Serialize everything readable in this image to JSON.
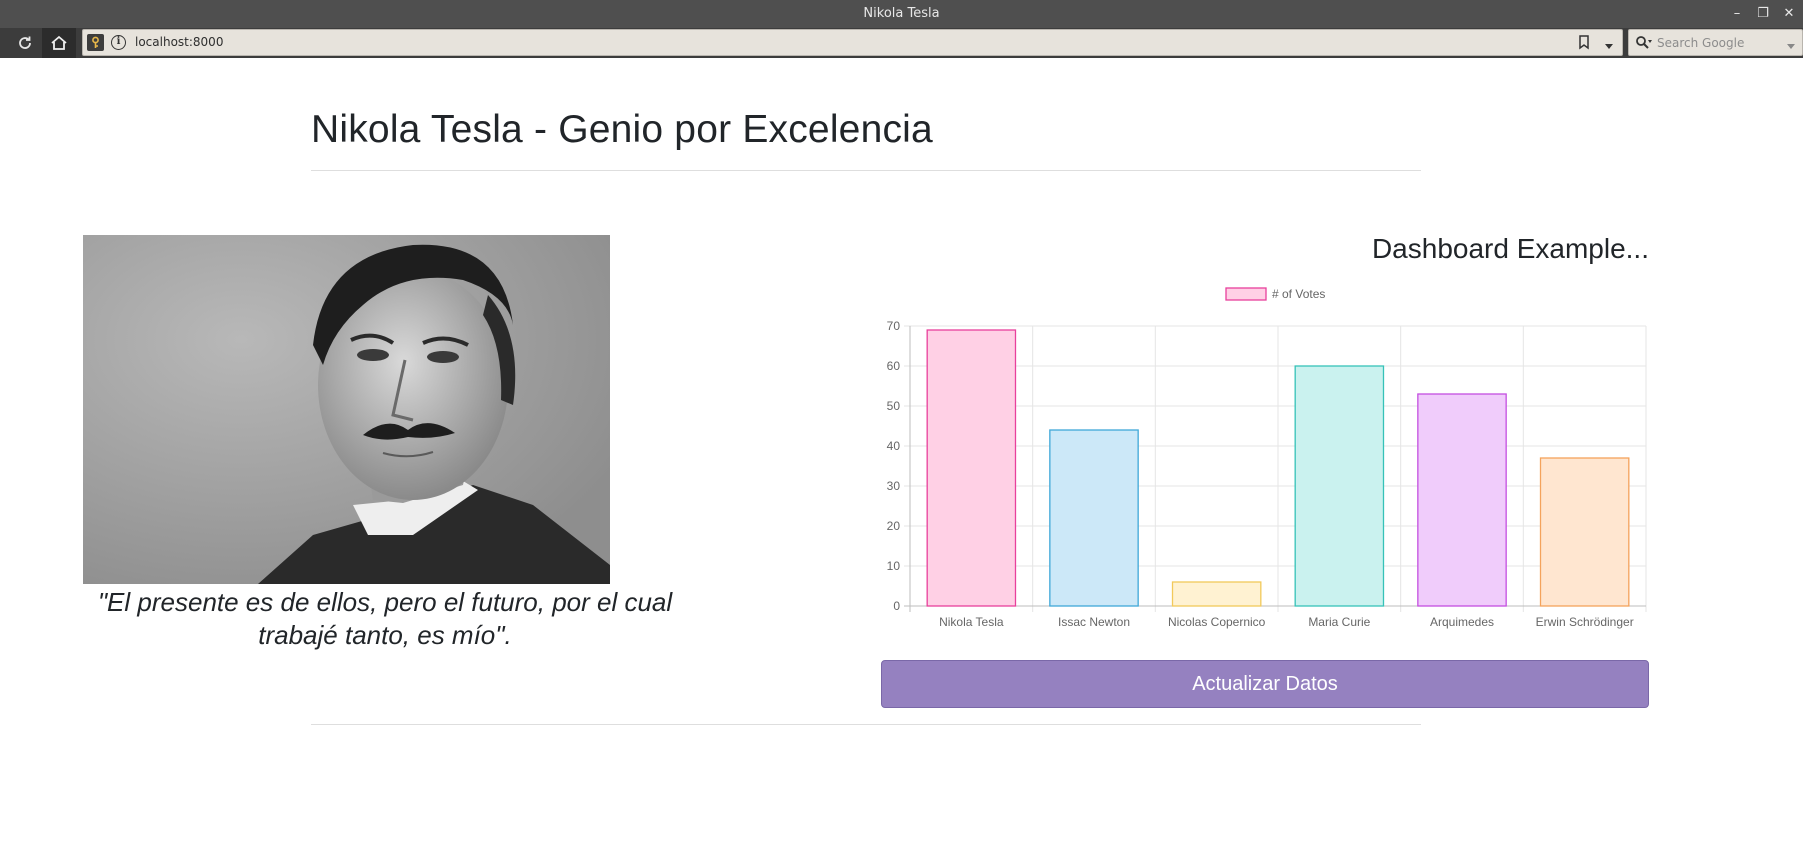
{
  "browser": {
    "window_title": "Nikola Tesla",
    "url": "localhost:8000",
    "search_placeholder": "Search Google"
  },
  "page": {
    "heading": "Nikola Tesla - Genio por Excelencia",
    "quote": "\"El presente es de ellos, pero el futuro, por el cual trabajé tanto, es mío\".",
    "dashboard_title": "Dashboard Example...",
    "update_button": "Actualizar Datos"
  },
  "chart_data": {
    "type": "bar",
    "categories": [
      "Nikola Tesla",
      "Issac Newton",
      "Nicolas Copernico",
      "Maria Curie",
      "Arquimedes",
      "Erwin Schrödinger"
    ],
    "series": [
      {
        "name": "# of Votes",
        "values": [
          69,
          44,
          6,
          60,
          53,
          37
        ]
      }
    ],
    "ylim": [
      0,
      70
    ],
    "yticks": [
      0,
      10,
      20,
      30,
      40,
      50,
      60,
      70
    ],
    "legend_position": "top",
    "grid": true,
    "fill_colors": [
      "#ffd0e5",
      "#cce8f8",
      "#fff2d2",
      "#caf2ef",
      "#f0ccfb",
      "#ffe6d0"
    ],
    "border_colors": [
      "#e8409c",
      "#3fa8d8",
      "#f2c95a",
      "#36c2b8",
      "#c44fe0",
      "#f4a35c"
    ]
  }
}
